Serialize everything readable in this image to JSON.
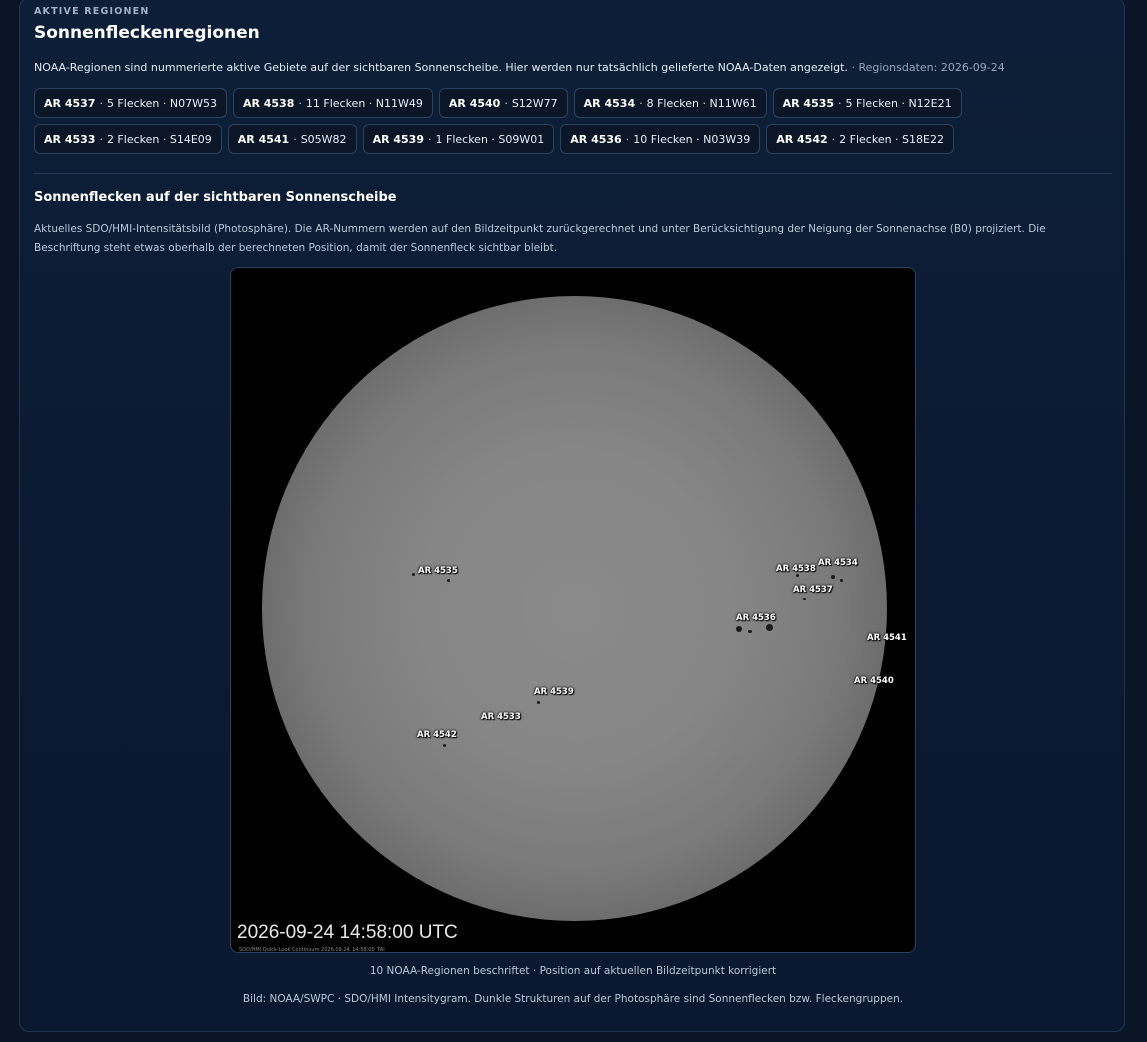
{
  "header": {
    "eyebrow": "AKTIVE REGIONEN",
    "title": "Sonnenfleckenregionen",
    "description": "NOAA-Regionen sind nummerierte aktive Gebiete auf der sichtbaren Sonnenscheibe. Hier werden nur tatsächlich gelieferte NOAA-Daten angezeigt.",
    "region_date": "· Regionsdaten: 2026-09-24"
  },
  "regions": [
    {
      "ar": "AR 4537",
      "info": "5 Flecken · N07W53"
    },
    {
      "ar": "AR 4538",
      "info": "11 Flecken · N11W49"
    },
    {
      "ar": "AR 4540",
      "info": "S12W77"
    },
    {
      "ar": "AR 4534",
      "info": "8 Flecken · N11W61"
    },
    {
      "ar": "AR 4535",
      "info": "5 Flecken · N12E21"
    },
    {
      "ar": "AR 4533",
      "info": "2 Flecken · S14E09"
    },
    {
      "ar": "AR 4541",
      "info": "S05W82"
    },
    {
      "ar": "AR 4539",
      "info": "1 Flecken · S09W01"
    },
    {
      "ar": "AR 4536",
      "info": "10 Flecken · N03W39"
    },
    {
      "ar": "AR 4542",
      "info": "2 Flecken · S18E22"
    }
  ],
  "section": {
    "title": "Sonnenflecken auf der sichtbaren Sonnenscheibe",
    "description": "Aktuelles SDO/HMI-Intensitätsbild (Photosphäre). Die AR-Nummern werden auf den Bildzeitpunkt zurückgerechnet und unter Berücksichtigung der Neigung der Sonnenachse (B0) projiziert. Die Beschriftung steht etwas oberhalb der berechneten Position, damit der Sonnenfleck sichtbar bleibt."
  },
  "image": {
    "timestamp": "2026-09-24 14:58:00 UTC",
    "fine_print": "SDO/HMI Quick-Look Continuum   2026.09.24_14:58:00_TAI",
    "labels": [
      "AR 4535",
      "AR 4538",
      "AR 4534",
      "AR 4537",
      "AR 4536",
      "AR 4541",
      "AR 4540",
      "AR 4539",
      "AR 4533",
      "AR 4542"
    ]
  },
  "footer": {
    "caption": "10 NOAA-Regionen beschriftet · Position auf aktuellen Bildzeitpunkt korrigiert",
    "credit": "Bild: NOAA/SWPC · SDO/HMI Intensitygram. Dunkle Strukturen auf der Photosphäre sind Sonnenflecken bzw. Fleckengruppen."
  },
  "colors": {
    "background": "#0a1628",
    "panel": "#0d1f38",
    "border": "#2b4260",
    "muted_text": "#93a6bd"
  }
}
